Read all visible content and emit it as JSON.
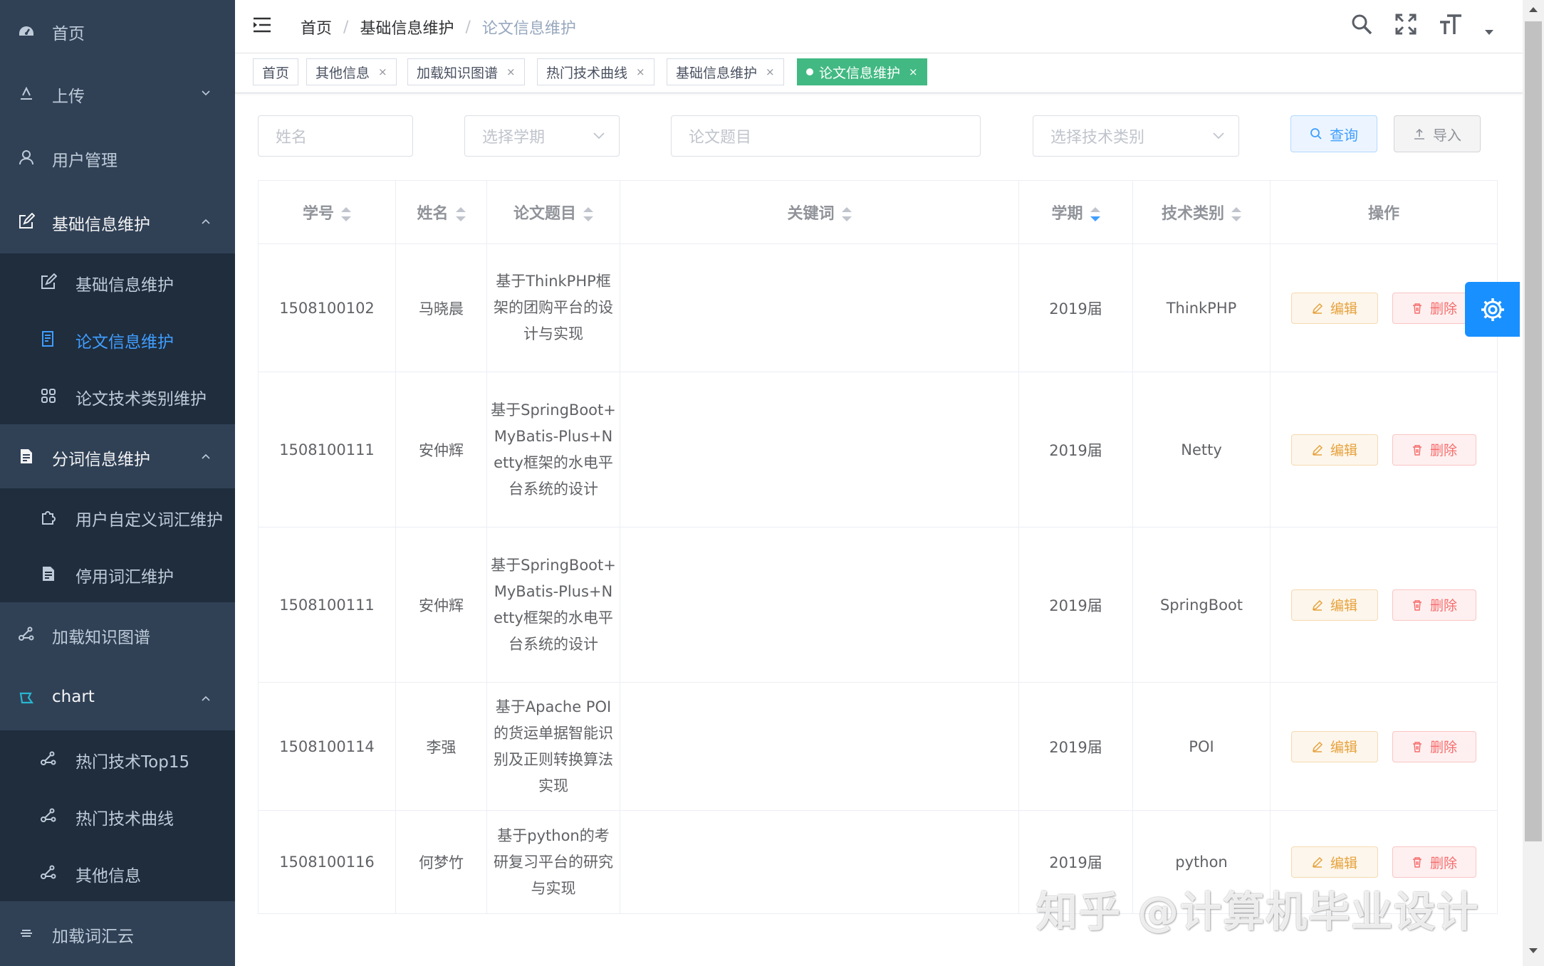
{
  "sidebar": {
    "items": [
      {
        "label": "首页",
        "icon": "dashboard-icon"
      },
      {
        "label": "上传",
        "icon": "upload-icon"
      },
      {
        "label": "用户管理",
        "icon": "user-icon"
      },
      {
        "label": "基础信息维护",
        "icon": "edit-icon"
      },
      {
        "label": "基础信息维护",
        "icon": "edit-icon"
      },
      {
        "label": "论文信息维护",
        "icon": "document-icon"
      },
      {
        "label": "论文技术类别维护",
        "icon": "grid-icon"
      },
      {
        "label": "分词信息维护",
        "icon": "file-icon"
      },
      {
        "label": "用户自定义词汇维护",
        "icon": "puzzle-icon"
      },
      {
        "label": "停用词汇维护",
        "icon": "file-icon"
      },
      {
        "label": "加载知识图谱",
        "icon": "graph-icon"
      },
      {
        "label": "chart",
        "icon": "chart-icon"
      },
      {
        "label": "热门技术Top15",
        "icon": "graph-icon"
      },
      {
        "label": "热门技术曲线",
        "icon": "graph-icon"
      },
      {
        "label": "其他信息",
        "icon": "graph-icon"
      },
      {
        "label": "加载词汇云",
        "icon": "cloud-icon"
      }
    ]
  },
  "breadcrumb": {
    "home": "首页",
    "level1": "基础信息维护",
    "current": "论文信息维护",
    "sep": "/"
  },
  "tags": [
    {
      "label": "首页"
    },
    {
      "label": "其他信息",
      "close": "×"
    },
    {
      "label": "加载知识图谱",
      "close": "×"
    },
    {
      "label": "热门技术曲线",
      "close": "×"
    },
    {
      "label": "基础信息维护",
      "close": "×"
    },
    {
      "label": "论文信息维护",
      "close": "×"
    }
  ],
  "filters": {
    "name_placeholder": "姓名",
    "term_placeholder": "选择学期",
    "title_placeholder": "论文题目",
    "category_placeholder": "选择技术类别",
    "query_label": "查询",
    "import_label": "导入"
  },
  "table": {
    "columns": [
      "学号",
      "姓名",
      "论文题目",
      "关键词",
      "学期",
      "技术类别",
      "操作"
    ],
    "edit_label": "编辑",
    "delete_label": "删除",
    "rows": [
      {
        "id": "1508100102",
        "name": "马晓晨",
        "title": "基于ThinkPHP框架的团购平台的设计与实现",
        "keywords": "",
        "term": "2019届",
        "category": "ThinkPHP"
      },
      {
        "id": "1508100111",
        "name": "安仲辉",
        "title": "基于SpringBoot+MyBatis-Plus+Netty框架的水电平台系统的设计",
        "keywords": "",
        "term": "2019届",
        "category": "Netty"
      },
      {
        "id": "1508100111",
        "name": "安仲辉",
        "title": "基于SpringBoot+MyBatis-Plus+Netty框架的水电平台系统的设计",
        "keywords": "",
        "term": "2019届",
        "category": "SpringBoot"
      },
      {
        "id": "1508100114",
        "name": "李强",
        "title": "基于Apache POI的货运单据智能识别及正则转换算法实现",
        "keywords": "",
        "term": "2019届",
        "category": "POI"
      },
      {
        "id": "1508100116",
        "name": "何梦竹",
        "title": "基于python的考研复习平台的研究与实现",
        "keywords": "",
        "term": "2019届",
        "category": "python"
      }
    ]
  },
  "watermark": "知乎 @计算机毕业设计",
  "colors": {
    "sidebar_bg": "#304156",
    "submenu_bg": "#1f2d3d",
    "active": "#409eff",
    "tag_active": "#42b983",
    "settings": "#1890ff"
  }
}
